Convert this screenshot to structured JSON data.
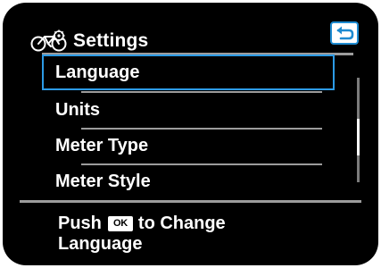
{
  "header": {
    "title": "Settings",
    "icon": "bicycle-icon",
    "back_icon": "return-arrow-icon"
  },
  "menu": {
    "items": [
      {
        "label": "Language",
        "selected": true
      },
      {
        "label": "Units",
        "selected": false
      },
      {
        "label": "Meter Type",
        "selected": false
      },
      {
        "label": "Meter Style",
        "selected": false
      }
    ]
  },
  "scrollbar": {
    "visible_fraction": 0.35,
    "position_fraction": 0.6
  },
  "footer": {
    "prefix": "Push",
    "button_badge": "OK",
    "suffix": "to Change",
    "line2": "Language"
  },
  "colors": {
    "background": "#000000",
    "text": "#ffffff",
    "selection": "#2c9be6",
    "separator": "#9c9c9c",
    "back_button_border": "#1e8bd1"
  }
}
